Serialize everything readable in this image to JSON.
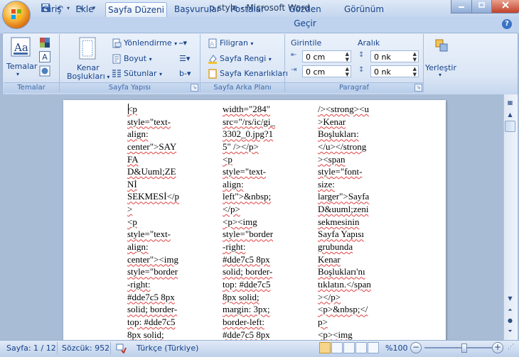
{
  "window": {
    "title": "p style - Microsoft Word"
  },
  "tabs": [
    "Giriş",
    "Ekle",
    "Sayfa Düzeni",
    "Başvurular",
    "Postalar",
    "Gözden Geçir",
    "Görünüm"
  ],
  "active_tab": "Sayfa Düzeni",
  "ribbon": {
    "temalar": {
      "button": "Temalar",
      "label": "Temalar"
    },
    "sayfa_yapisi": {
      "kenar_line1": "Kenar",
      "kenar_line2": "Boşlukları",
      "yonlendirme": "Yönlendirme",
      "boyut": "Boyut",
      "sutunlar": "Sütunlar",
      "label": "Sayfa Yapısı"
    },
    "sayfa_arka_plani": {
      "filigran": "Filigran",
      "sayfa_rengi": "Sayfa Rengi",
      "sayfa_kenarliklari": "Sayfa Kenarlıkları",
      "label": "Sayfa Arka Planı"
    },
    "paragraf": {
      "girinti": "Girintile",
      "aralik": "Aralık",
      "sol": "0 cm",
      "sag": "0 cm",
      "once": "0 nk",
      "sonra": "0 nk",
      "label": "Paragraf"
    },
    "yerlestir": {
      "label": "Yerleştir"
    }
  },
  "document": {
    "col1": [
      "<p",
      "style=\"text-",
      "align:",
      "center\">SAY",
      "FA",
      "D&Uuml;ZE",
      "Nİ",
      "SEKMESİ</p",
      ">",
      "<p",
      "style=\"text-",
      "align:",
      "center\"><img",
      "style=\"border",
      "-right:",
      "#dde7c5 8px",
      "solid; border-",
      "top: #dde7c5",
      "8px solid;"
    ],
    "col2": [
      "width=\"284\"",
      "src=\"/rs/ic/gi_",
      "3302_0.jpg?1",
      "5\" /></p>",
      "<p",
      "style=\"text-",
      "align:",
      "left\">&nbsp;",
      "</p>",
      "<p><img",
      "style=\"border",
      "-right:",
      "#dde7c5 8px",
      "solid; border-",
      "top: #dde7c5",
      "8px solid;",
      "margin: 3px;",
      "border-left:",
      "#dde7c5 8px"
    ],
    "col3": [
      "/><strong><u",
      ">Kenar",
      "Boşlukları:",
      "</u></strong",
      "><span",
      "style=\"font-",
      "size:",
      "larger\">Sayfa",
      "D&uuml;zeni",
      "sekmesinin",
      "Sayfa Yapısı",
      "grubunda",
      "Kenar",
      "Boşlukları'nı",
      "tıklatın.</span",
      "></p>",
      "<p>&nbsp;</",
      "p>",
      "<p><img"
    ]
  },
  "status": {
    "page": "Sayfa: 1 / 12",
    "words": "Sözcük: 952",
    "language": "Türkçe (Türkiye)",
    "zoom": "%100",
    "zoom_level": 1.0
  }
}
